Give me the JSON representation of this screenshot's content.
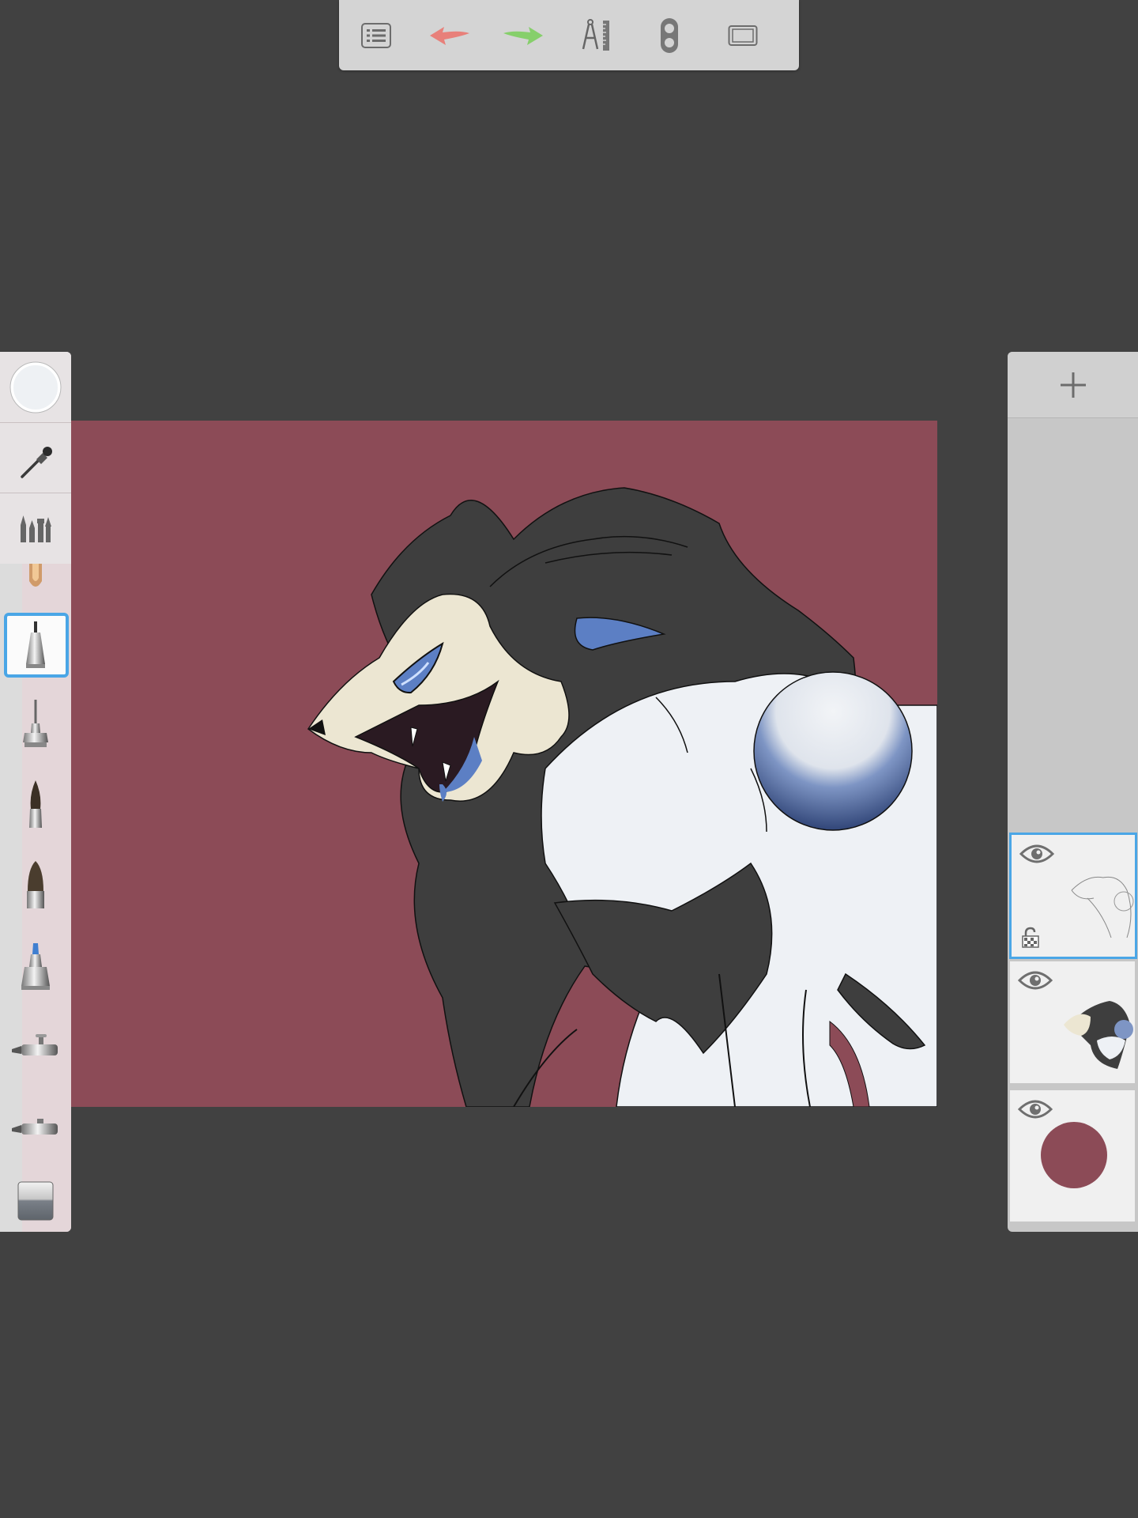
{
  "toolbar": {
    "items": [
      {
        "name": "menu-button",
        "icon": "list-icon"
      },
      {
        "name": "undo-button",
        "icon": "undo-arrow-icon",
        "color": "#e8807a"
      },
      {
        "name": "redo-button",
        "icon": "redo-arrow-icon",
        "color": "#86cf6b"
      },
      {
        "name": "guides-button",
        "icon": "compass-ruler-icon"
      },
      {
        "name": "symmetry-button",
        "icon": "toggle-icon"
      },
      {
        "name": "fullscreen-button",
        "icon": "fullscreen-icon"
      }
    ]
  },
  "palette": {
    "current_color": "#eef1f4",
    "tools": [
      "color-puck",
      "eyedropper",
      "brush-library",
      "pencil",
      "ballpoint-pen",
      "fineliner",
      "paintbrush",
      "flat-brush",
      "marker",
      "airbrush",
      "smudge",
      "eraser"
    ],
    "selected_tool": "ballpoint-pen"
  },
  "canvas": {
    "background_color": "#8c4b57"
  },
  "layers": {
    "items": [
      {
        "name": "sketch-layer",
        "visible": true,
        "selected": true,
        "locked": false
      },
      {
        "name": "color-layer",
        "visible": true,
        "selected": false
      },
      {
        "name": "background-layer",
        "visible": true,
        "selected": false,
        "swatch_color": "#8c4b57"
      }
    ]
  },
  "colors": {
    "ui_background": "#414141",
    "selection_accent": "#4aa6e6",
    "fur_dark": "#3e3e3e",
    "fur_light": "#eef1f5",
    "skull": "#ece6d2",
    "accent_blue": "#5c7fc4"
  }
}
